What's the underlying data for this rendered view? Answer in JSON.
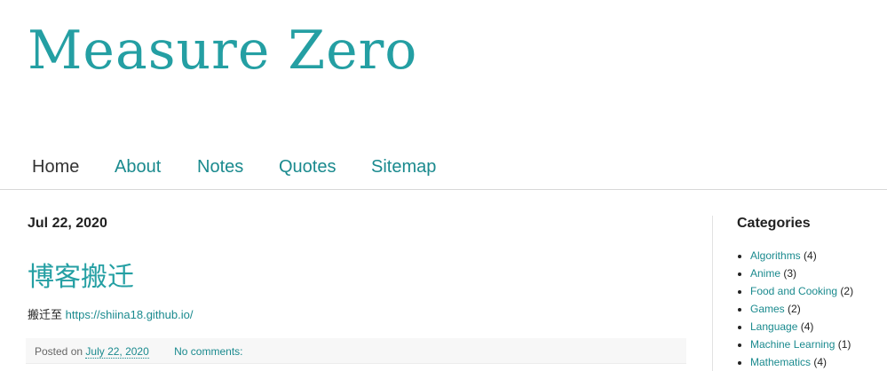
{
  "blog": {
    "title": "Measure Zero"
  },
  "nav": {
    "tabs": [
      {
        "label": "Home"
      },
      {
        "label": "About"
      },
      {
        "label": "Notes"
      },
      {
        "label": "Quotes"
      },
      {
        "label": "Sitemap"
      }
    ]
  },
  "post": {
    "date_header": "Jul 22, 2020",
    "title": "博客搬迁",
    "body_prefix": "搬迁至",
    "body_link": "https://shiina18.github.io/",
    "footer": {
      "posted_on": "Posted on",
      "timestamp": "July 22, 2020",
      "comments": "No comments:"
    }
  },
  "sidebar": {
    "heading": "Categories",
    "categories": [
      {
        "name": "Algorithms",
        "count": "(4)"
      },
      {
        "name": "Anime",
        "count": "(3)"
      },
      {
        "name": "Food and Cooking",
        "count": "(2)"
      },
      {
        "name": "Games",
        "count": "(2)"
      },
      {
        "name": "Language",
        "count": "(4)"
      },
      {
        "name": "Machine Learning",
        "count": "(1)"
      },
      {
        "name": "Mathematics",
        "count": "(4)"
      }
    ]
  },
  "colors": {
    "accent": "#249fa3",
    "link": "#1a8a8e"
  }
}
